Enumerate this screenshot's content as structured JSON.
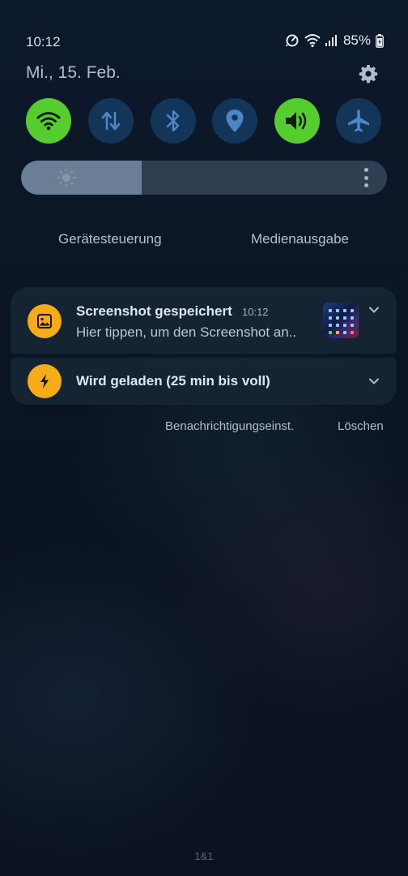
{
  "status_bar": {
    "time": "10:12",
    "battery_percent": "85%",
    "icons": [
      "data-saver-icon",
      "wifi-icon",
      "signal-icon",
      "battery-charging-icon"
    ]
  },
  "header": {
    "date": "Mi., 15. Feb.",
    "settings_icon": "gear-icon"
  },
  "quick_settings": {
    "tiles": [
      {
        "name": "wifi",
        "icon": "wifi-icon",
        "on": true
      },
      {
        "name": "mobile-data",
        "icon": "data-transfer-icon",
        "on": false
      },
      {
        "name": "bluetooth",
        "icon": "bluetooth-icon",
        "on": false
      },
      {
        "name": "location",
        "icon": "location-pin-icon",
        "on": false
      },
      {
        "name": "sound",
        "icon": "speaker-icon",
        "on": true
      },
      {
        "name": "airplane-mode",
        "icon": "airplane-icon",
        "on": false
      }
    ],
    "brightness_level": 0.33
  },
  "links": {
    "device_control": "Gerätesteuerung",
    "media_output": "Medienausgabe"
  },
  "notifications": [
    {
      "icon": "image-icon",
      "title": "Screenshot gespeichert",
      "time": "10:12",
      "body": "Hier tippen, um den Screenshot an.."
    },
    {
      "icon": "charging-bolt-icon",
      "title": "Wird geladen (25 min bis voll)"
    }
  ],
  "notification_actions": {
    "settings": "Benachrichtigungseinst.",
    "clear": "Löschen"
  },
  "carrier": "1&1",
  "colors": {
    "tile_on": "#56cd2f",
    "tile_off": "#13355a",
    "notif_icon": "#f6ac17",
    "card_bg": "#152433"
  }
}
